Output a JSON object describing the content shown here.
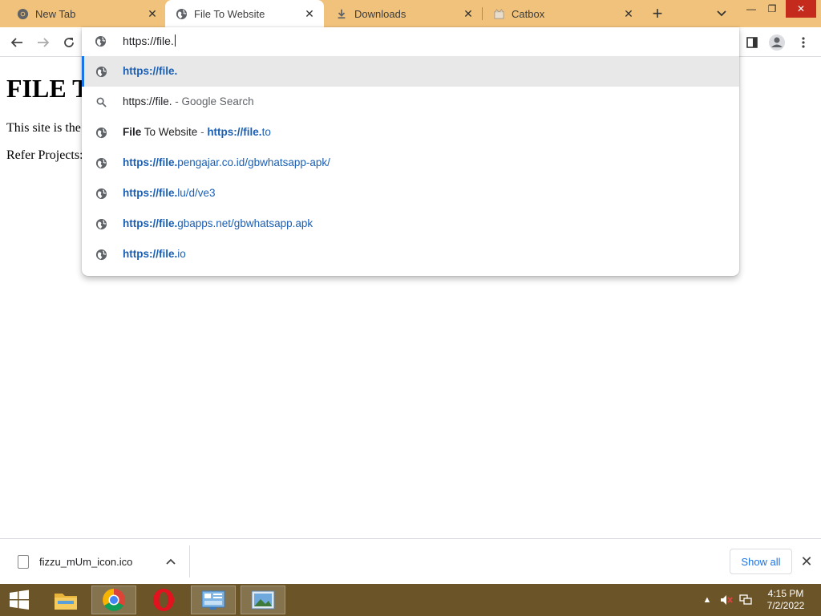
{
  "tabs": [
    {
      "label": "New Tab"
    },
    {
      "label": "File To Website"
    },
    {
      "label": "Downloads"
    },
    {
      "label": "Catbox"
    }
  ],
  "omnibox": {
    "input_value": "https://file.",
    "suggestions": [
      {
        "bold": "https://file.",
        "rest": "",
        "suffix": ""
      },
      {
        "bold": "",
        "rest": "https://file.",
        "suffix": " - Google Search"
      },
      {
        "title_bold": "File",
        "title_rest": " To Website",
        "sep": " - ",
        "bold": "https://file.",
        "rest": "to"
      },
      {
        "bold": "https://file.",
        "rest": "pengajar.co.id/gbwhatsapp-apk/"
      },
      {
        "bold": "https://file.",
        "rest": "lu/d/ve3"
      },
      {
        "bold": "https://file.",
        "rest": "gbapps.net/gbwhatsapp.apk"
      },
      {
        "bold": "https://file.",
        "rest": "io"
      }
    ]
  },
  "page": {
    "heading": "FILE T",
    "line1": "This site is the",
    "line2": "Refer Projects:"
  },
  "download_shelf": {
    "filename": "fizzu_mUm_icon.ico",
    "show_all": "Show all"
  },
  "taskbar": {
    "time": "4:15 PM",
    "date": "7/2/2022"
  },
  "colors": {
    "tabstrip": "#f1c27b",
    "taskbar": "#6b5528",
    "link_blue": "#1a5fb4",
    "selection_bar": "#1a73e8"
  }
}
